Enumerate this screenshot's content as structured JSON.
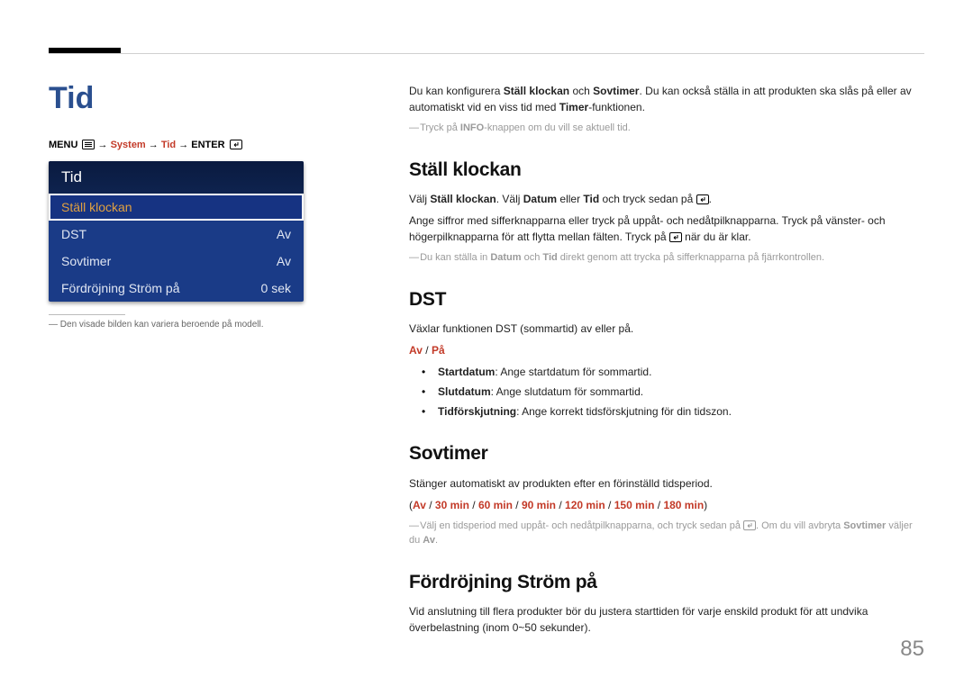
{
  "pageTitle": "Tid",
  "breadcrumb": {
    "menuLabel": "MENU",
    "arrow": " → ",
    "system": "System",
    "tid": "Tid",
    "enter": "ENTER"
  },
  "osd": {
    "title": "Tid",
    "items": [
      {
        "label": "Ställ klockan",
        "value": "",
        "selected": true
      },
      {
        "label": "DST",
        "value": "Av",
        "selected": false
      },
      {
        "label": "Sovtimer",
        "value": "Av",
        "selected": false
      },
      {
        "label": "Fördröjning Ström på",
        "value": "0 sek",
        "selected": false
      }
    ]
  },
  "leftFootnote": "Den visade bilden kan variera beroende på modell.",
  "intro": {
    "line1_a": "Du kan konfigurera ",
    "line1_b": "Ställ klockan",
    "line1_c": " och ",
    "line1_d": "Sovtimer",
    "line1_e": ". Du kan också ställa in att produkten ska slås på eller av automatiskt vid en viss tid med ",
    "line1_f": "Timer",
    "line1_g": "-funktionen.",
    "note_a": "Tryck på ",
    "note_b": "INFO",
    "note_c": "-knappen om du vill se aktuell tid."
  },
  "sections": {
    "stall": {
      "title": "Ställ klockan",
      "p1_a": "Välj ",
      "p1_b": "Ställ klockan",
      "p1_c": ". Välj ",
      "p1_d": "Datum",
      "p1_e": " eller ",
      "p1_f": "Tid",
      "p1_g": " och tryck sedan på ",
      "p2": "Ange siffror med sifferknapparna eller tryck på uppåt- och nedåtpilknapparna. Tryck på vänster- och högerpilknapparna för att flytta mellan fälten. Tryck på ",
      "p2b": " när du är klar.",
      "note_a": "Du kan ställa in ",
      "note_b": "Datum",
      "note_c": " och ",
      "note_d": "Tid",
      "note_e": " direkt genom att trycka på sifferknapparna på fjärrkontrollen."
    },
    "dst": {
      "title": "DST",
      "p1": "Växlar funktionen DST (sommartid) av eller på.",
      "opts": [
        "Av",
        "På"
      ],
      "bullets": [
        {
          "b": "Startdatum",
          "t": ": Ange startdatum för sommartid."
        },
        {
          "b": "Slutdatum",
          "t": ": Ange slutdatum för sommartid."
        },
        {
          "b": "Tidförskjutning",
          "t": ": Ange korrekt tidsförskjutning för din tidszon."
        }
      ]
    },
    "sov": {
      "title": "Sovtimer",
      "p1": "Stänger automatiskt av produkten efter en förinställd tidsperiod.",
      "opts": [
        "Av",
        "30 min",
        "60 min",
        "90 min",
        "120 min",
        "150 min",
        "180 min"
      ],
      "note_a": "Välj en tidsperiod med uppåt- och nedåtpilknapparna, och tryck sedan på ",
      "note_b": ". Om du vill avbryta ",
      "note_c": "Sovtimer",
      "note_d": " väljer du ",
      "note_e": "Av",
      "note_f": "."
    },
    "ford": {
      "title": "Fördröjning Ström på",
      "p1": "Vid anslutning till flera produkter bör du justera starttiden för varje enskild produkt för att undvika överbelastning (inom 0~50 sekunder)."
    }
  },
  "pageNumber": "85"
}
